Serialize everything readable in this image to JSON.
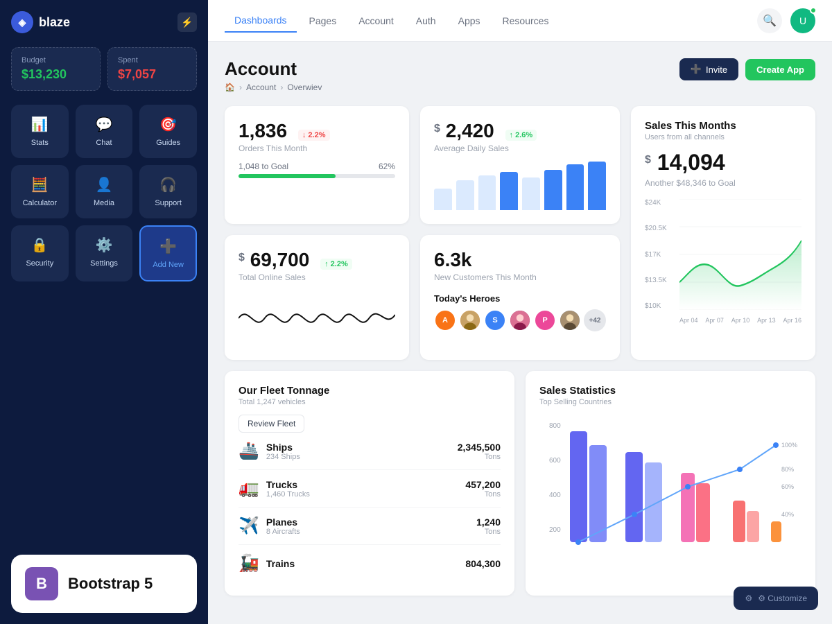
{
  "app": {
    "name": "blaze"
  },
  "sidebar": {
    "budget_label": "Budget",
    "budget_value": "$13,230",
    "spent_label": "Spent",
    "spent_value": "$7,057",
    "nav_items": [
      {
        "id": "stats",
        "label": "Stats",
        "icon": "📊"
      },
      {
        "id": "chat",
        "label": "Chat",
        "icon": "💬"
      },
      {
        "id": "guides",
        "label": "Guides",
        "icon": "🎯"
      },
      {
        "id": "calculator",
        "label": "Calculator",
        "icon": "🧮"
      },
      {
        "id": "media",
        "label": "Media",
        "icon": "👤"
      },
      {
        "id": "support",
        "label": "Support",
        "icon": "🎧"
      },
      {
        "id": "security",
        "label": "Security",
        "icon": "🔒"
      },
      {
        "id": "settings",
        "label": "Settings",
        "icon": "⚙️"
      },
      {
        "id": "add-new",
        "label": "+ Add New",
        "icon": "+",
        "type": "add"
      }
    ],
    "branding": {
      "name": "Bootstrap 5",
      "letter": "B"
    }
  },
  "topnav": {
    "links": [
      {
        "id": "dashboards",
        "label": "Dashboards",
        "active": true
      },
      {
        "id": "pages",
        "label": "Pages"
      },
      {
        "id": "account",
        "label": "Account"
      },
      {
        "id": "auth",
        "label": "Auth"
      },
      {
        "id": "apps",
        "label": "Apps"
      },
      {
        "id": "resources",
        "label": "Resources"
      }
    ]
  },
  "page": {
    "title": "Account",
    "breadcrumbs": [
      "🏠",
      "Account",
      "Overwiev"
    ],
    "actions": {
      "invite": "Invite",
      "create_app": "Create App"
    }
  },
  "stats": {
    "orders": {
      "value": "1,836",
      "label": "Orders This Month",
      "badge": "↓ 2.2%",
      "badge_type": "down",
      "progress_label": "1,048 to Goal",
      "progress_pct": "62%",
      "progress_value": 62
    },
    "sales": {
      "prefix": "$",
      "value": "2,420",
      "label": "Average Daily Sales",
      "badge": "↑ 2.6%",
      "badge_type": "up",
      "bars": [
        40,
        55,
        65,
        70,
        60,
        75,
        85,
        90
      ]
    },
    "monthly_sales": {
      "title": "Sales This Months",
      "subtitle": "Users from all channels",
      "prefix": "$",
      "value": "14,094",
      "goal_text": "Another $48,346 to Goal",
      "y_labels": [
        "$24K",
        "$20.5K",
        "$17K",
        "$13.5K",
        "$10K"
      ],
      "x_labels": [
        "Apr 04",
        "Apr 07",
        "Apr 10",
        "Apr 13",
        "Apr 16"
      ]
    }
  },
  "online_sales": {
    "prefix": "$",
    "value": "69,700",
    "badge": "↑ 2.2%",
    "badge_type": "up",
    "label": "Total Online Sales"
  },
  "customers": {
    "value": "6.3k",
    "label": "New Customers This Month"
  },
  "heroes": {
    "title": "Today's Heroes",
    "avatars": [
      {
        "color": "#f97316",
        "letter": "A"
      },
      {
        "color": "#8b5cf6",
        "letter": "S"
      },
      {
        "color": "#ec4899",
        "letter": "P"
      }
    ],
    "extra": "+42"
  },
  "fleet": {
    "title": "Our Fleet Tonnage",
    "subtitle": "Total 1,247 vehicles",
    "review_btn": "Review Fleet",
    "items": [
      {
        "icon": "🚢",
        "name": "Ships",
        "count": "234 Ships",
        "value": "2,345,500",
        "unit": "Tons"
      },
      {
        "icon": "🚛",
        "name": "Trucks",
        "count": "1,460 Trucks",
        "value": "457,200",
        "unit": "Tons"
      },
      {
        "icon": "✈️",
        "name": "Planes",
        "count": "8 Aircrafts",
        "value": "1,240",
        "unit": "Tons"
      },
      {
        "icon": "🚂",
        "name": "Trains",
        "count": "",
        "value": "804,300",
        "unit": ""
      }
    ]
  },
  "sales_statistics": {
    "title": "Sales Statistics",
    "subtitle": "Top Selling Countries",
    "y_labels": [
      "800",
      "600",
      "400",
      "200"
    ],
    "line_pcts": [
      "40%",
      "60%",
      "80%",
      "100%"
    ]
  },
  "customize": {
    "label": "⚙ Customize"
  }
}
